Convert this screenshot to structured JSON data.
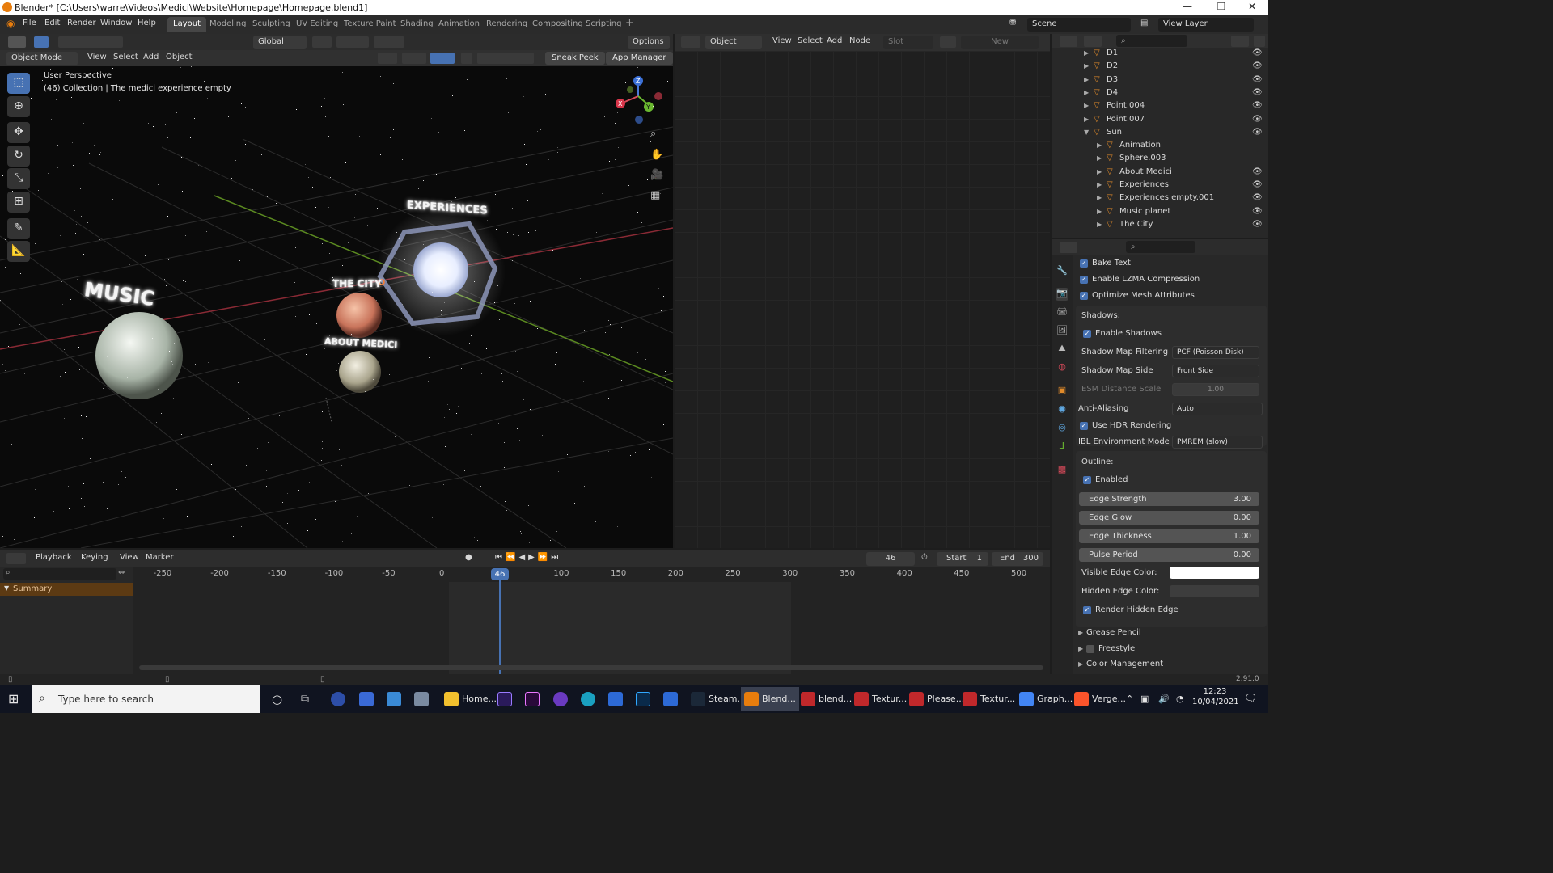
{
  "window": {
    "title": "Blender* [C:\\Users\\warre\\Videos\\Medici\\Website\\Homepage\\Homepage.blend1]",
    "controls": [
      "—",
      "❐",
      "✕"
    ]
  },
  "menu": [
    "File",
    "Edit",
    "Render",
    "Window",
    "Help"
  ],
  "workspaces": [
    "Layout",
    "Modeling",
    "Sculpting",
    "UV Editing",
    "Texture Paint",
    "Shading",
    "Animation",
    "Rendering",
    "Compositing",
    "Scripting"
  ],
  "active_workspace": "Layout",
  "scene": {
    "name": "Scene",
    "view_layer": "View Layer"
  },
  "viewport": {
    "transform_orientation": "Global",
    "options_label": "Options",
    "mode": "Object Mode",
    "menus": [
      "View",
      "Select",
      "Add",
      "Object"
    ],
    "sneak_peek": "Sneak Peek",
    "app_manager": "App Manager",
    "overlay_line1": "User Perspective",
    "overlay_line2": "(46) Collection | The medici experience empty",
    "labels_3d": [
      "EXPERIENCES",
      "MUSIC",
      "THE CITY",
      "ABOUT MEDICI"
    ],
    "gizmo_axes": [
      "X",
      "Y",
      "Z"
    ]
  },
  "node_editor": {
    "type": "Object",
    "menus": [
      "View",
      "Select",
      "Add",
      "Node"
    ],
    "slot": "Slot",
    "new_label": "New"
  },
  "outliner": {
    "items": [
      {
        "label": "D1",
        "indent": 0,
        "expanded": false,
        "eye": true
      },
      {
        "label": "D2",
        "indent": 0,
        "expanded": false,
        "eye": true
      },
      {
        "label": "D3",
        "indent": 0,
        "expanded": false,
        "eye": true
      },
      {
        "label": "D4",
        "indent": 0,
        "expanded": false,
        "eye": true
      },
      {
        "label": "Point.004",
        "indent": 0,
        "expanded": false,
        "eye": true
      },
      {
        "label": "Point.007",
        "indent": 0,
        "expanded": false,
        "eye": true
      },
      {
        "label": "Sun",
        "indent": 0,
        "expanded": true,
        "eye": true
      },
      {
        "label": "Animation",
        "indent": 1,
        "expanded": false,
        "eye": false
      },
      {
        "label": "Sphere.003",
        "indent": 1,
        "expanded": false,
        "eye": false
      },
      {
        "label": "About Medici",
        "indent": 1,
        "expanded": false,
        "eye": true
      },
      {
        "label": "Experiences",
        "indent": 1,
        "expanded": false,
        "eye": true
      },
      {
        "label": "Experiences empty.001",
        "indent": 1,
        "expanded": false,
        "eye": true
      },
      {
        "label": "Music planet",
        "indent": 1,
        "expanded": false,
        "eye": true
      },
      {
        "label": "The City",
        "indent": 1,
        "expanded": false,
        "eye": true
      }
    ]
  },
  "properties": {
    "checks": [
      {
        "label": "Bake Text",
        "checked": true
      },
      {
        "label": "Enable LZMA Compression",
        "checked": true
      },
      {
        "label": "Optimize Mesh Attributes",
        "checked": true
      }
    ],
    "shadows_heading": "Shadows:",
    "enable_shadows": "Enable Shadows",
    "shadow_map_filtering": {
      "label": "Shadow Map Filtering",
      "value": "PCF (Poisson Disk)"
    },
    "shadow_map_side": {
      "label": "Shadow Map Side",
      "value": "Front Side"
    },
    "esm_distance_scale": {
      "label": "ESM Distance Scale",
      "value": "1.00"
    },
    "anti_aliasing": {
      "label": "Anti-Aliasing",
      "value": "Auto"
    },
    "use_hdr": "Use HDR Rendering",
    "ibl_mode": {
      "label": "IBL Environment Mode",
      "value": "PMREM (slow)"
    },
    "outline_heading": "Outline:",
    "outline_enabled": "Enabled",
    "sliders": [
      {
        "label": "Edge Strength",
        "value": "3.00"
      },
      {
        "label": "Edge Glow",
        "value": "0.00"
      },
      {
        "label": "Edge Thickness",
        "value": "1.00"
      },
      {
        "label": "Pulse Period",
        "value": "0.00"
      }
    ],
    "visible_edge_color": {
      "label": "Visible Edge Color:",
      "color": "#ffffff"
    },
    "hidden_edge_color": {
      "label": "Hidden Edge Color:",
      "color": "#3d3d3d"
    },
    "render_hidden_edge": "Render Hidden Edge",
    "panels": [
      "Grease Pencil",
      "Freestyle",
      "Color Management"
    ]
  },
  "timeline": {
    "menus": [
      "Playback",
      "Keying",
      "View",
      "Marker"
    ],
    "current_frame": "46",
    "start_label": "Start",
    "start": "1",
    "end_label": "End",
    "end": "300",
    "summary": "Summary",
    "ticks": [
      "-250",
      "-200",
      "-150",
      "-100",
      "-50",
      "0",
      "46",
      "100",
      "150",
      "200",
      "250",
      "300",
      "350",
      "400",
      "450",
      "500"
    ]
  },
  "status": {
    "version": "2.91.0"
  },
  "taskbar": {
    "search_placeholder": "Type here to search",
    "apps": [
      {
        "label": "Home...",
        "color": "#f2c02e"
      },
      {
        "label": "Steam...",
        "color": "#1b2838"
      },
      {
        "label": "Blend...",
        "color": "#e87d0d"
      },
      {
        "label": "blend...",
        "color": "#c0282b"
      },
      {
        "label": "Textur...",
        "color": "#c0282b"
      },
      {
        "label": "Please...",
        "color": "#c0282b"
      },
      {
        "label": "Textur...",
        "color": "#c0282b"
      },
      {
        "label": "Graph...",
        "color": "#4285f4"
      },
      {
        "label": "Verge...",
        "color": "#fb542b"
      }
    ],
    "time": "12:23",
    "date": "10/04/2021"
  },
  "colors": {
    "accent": "#4772b3",
    "blender_orange": "#e87d0d",
    "playhead": "#4772b3"
  }
}
